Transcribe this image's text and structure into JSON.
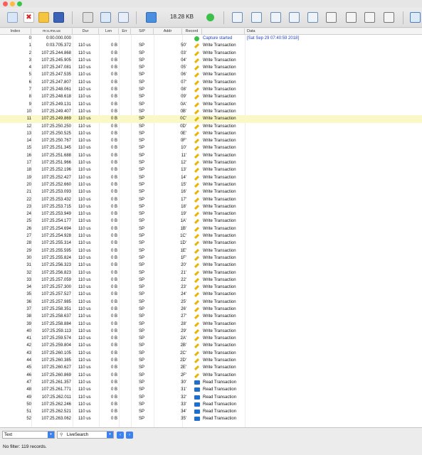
{
  "toolbar": {
    "capture_size": "18.28 KB"
  },
  "columns": {
    "index": "Index",
    "timestamp": "m:s.ms.us",
    "dur": "Dur",
    "len": "Len",
    "err": "Err",
    "sp": "S/P",
    "addr": "Addr",
    "record": "Record",
    "data": "Data"
  },
  "rows": [
    {
      "index": "0",
      "ts": "0:00.000.000",
      "dur": "",
      "len": "",
      "sp": "",
      "addr": "",
      "kind": "start",
      "record": "Capture started",
      "data": "[Sat Sep 29 07:40:59 2018]"
    },
    {
      "index": "1",
      "ts": "0:03.705.372",
      "dur": "110 us",
      "len": "0 B",
      "sp": "SP",
      "addr": "50'",
      "kind": "write",
      "record": "Write Transaction",
      "data": ""
    },
    {
      "index": "2",
      "ts": "107:25.244.868",
      "dur": "110 us",
      "len": "0 B",
      "sp": "SP",
      "addr": "03'",
      "kind": "write",
      "record": "Write Transaction",
      "data": ""
    },
    {
      "index": "3",
      "ts": "107:25.245.905",
      "dur": "110 us",
      "len": "0 B",
      "sp": "SP",
      "addr": "04'",
      "kind": "write",
      "record": "Write Transaction",
      "data": ""
    },
    {
      "index": "4",
      "ts": "107:25.247.081",
      "dur": "110 us",
      "len": "0 B",
      "sp": "SP",
      "addr": "05'",
      "kind": "write",
      "record": "Write Transaction",
      "data": ""
    },
    {
      "index": "5",
      "ts": "107:25.247.535",
      "dur": "110 us",
      "len": "0 B",
      "sp": "SP",
      "addr": "06'",
      "kind": "write",
      "record": "Write Transaction",
      "data": ""
    },
    {
      "index": "6",
      "ts": "107:25.247.807",
      "dur": "110 us",
      "len": "0 B",
      "sp": "SP",
      "addr": "07'",
      "kind": "write",
      "record": "Write Transaction",
      "data": ""
    },
    {
      "index": "7",
      "ts": "107:25.248.061",
      "dur": "110 us",
      "len": "0 B",
      "sp": "SP",
      "addr": "08'",
      "kind": "write",
      "record": "Write Transaction",
      "data": ""
    },
    {
      "index": "8",
      "ts": "107:25.248.618",
      "dur": "110 us",
      "len": "0 B",
      "sp": "SP",
      "addr": "09'",
      "kind": "write",
      "record": "Write Transaction",
      "data": ""
    },
    {
      "index": "9",
      "ts": "107:25.249.131",
      "dur": "110 us",
      "len": "0 B",
      "sp": "SP",
      "addr": "0A'",
      "kind": "write",
      "record": "Write Transaction",
      "data": ""
    },
    {
      "index": "10",
      "ts": "107:25.249.407",
      "dur": "110 us",
      "len": "0 B",
      "sp": "SP",
      "addr": "0B'",
      "kind": "write",
      "record": "Write Transaction",
      "data": ""
    },
    {
      "index": "11",
      "ts": "107:25.249.869",
      "dur": "110 us",
      "len": "0 B",
      "sp": "SP",
      "addr": "0C'",
      "kind": "write",
      "record": "Write Transaction",
      "data": "",
      "selected": true
    },
    {
      "index": "12",
      "ts": "107:25.250.250",
      "dur": "110 us",
      "len": "0 B",
      "sp": "SP",
      "addr": "0D'",
      "kind": "write",
      "record": "Write Transaction",
      "data": ""
    },
    {
      "index": "13",
      "ts": "107:25.250.525",
      "dur": "110 us",
      "len": "0 B",
      "sp": "SP",
      "addr": "0E'",
      "kind": "write",
      "record": "Write Transaction",
      "data": ""
    },
    {
      "index": "14",
      "ts": "107:25.250.767",
      "dur": "110 us",
      "len": "0 B",
      "sp": "SP",
      "addr": "0F'",
      "kind": "write",
      "record": "Write Transaction",
      "data": ""
    },
    {
      "index": "15",
      "ts": "107:25.251.345",
      "dur": "110 us",
      "len": "0 B",
      "sp": "SP",
      "addr": "10'",
      "kind": "write",
      "record": "Write Transaction",
      "data": ""
    },
    {
      "index": "16",
      "ts": "107:25.251.688",
      "dur": "110 us",
      "len": "0 B",
      "sp": "SP",
      "addr": "11'",
      "kind": "write",
      "record": "Write Transaction",
      "data": ""
    },
    {
      "index": "17",
      "ts": "107:25.251.966",
      "dur": "110 us",
      "len": "0 B",
      "sp": "SP",
      "addr": "12'",
      "kind": "write",
      "record": "Write Transaction",
      "data": ""
    },
    {
      "index": "18",
      "ts": "107:25.252.196",
      "dur": "110 us",
      "len": "0 B",
      "sp": "SP",
      "addr": "13'",
      "kind": "write",
      "record": "Write Transaction",
      "data": ""
    },
    {
      "index": "19",
      "ts": "107:25.252.427",
      "dur": "110 us",
      "len": "0 B",
      "sp": "SP",
      "addr": "14'",
      "kind": "write",
      "record": "Write Transaction",
      "data": ""
    },
    {
      "index": "20",
      "ts": "107:25.252.660",
      "dur": "110 us",
      "len": "0 B",
      "sp": "SP",
      "addr": "15'",
      "kind": "write",
      "record": "Write Transaction",
      "data": ""
    },
    {
      "index": "21",
      "ts": "107:25.253.093",
      "dur": "110 us",
      "len": "0 B",
      "sp": "SP",
      "addr": "16'",
      "kind": "write",
      "record": "Write Transaction",
      "data": ""
    },
    {
      "index": "22",
      "ts": "107:25.253.432",
      "dur": "110 us",
      "len": "0 B",
      "sp": "SP",
      "addr": "17'",
      "kind": "write",
      "record": "Write Transaction",
      "data": ""
    },
    {
      "index": "23",
      "ts": "107:25.253.715",
      "dur": "110 us",
      "len": "0 B",
      "sp": "SP",
      "addr": "18'",
      "kind": "write",
      "record": "Write Transaction",
      "data": ""
    },
    {
      "index": "24",
      "ts": "107:25.253.949",
      "dur": "110 us",
      "len": "0 B",
      "sp": "SP",
      "addr": "19'",
      "kind": "write",
      "record": "Write Transaction",
      "data": ""
    },
    {
      "index": "25",
      "ts": "107:25.254.177",
      "dur": "110 us",
      "len": "0 B",
      "sp": "SP",
      "addr": "1A'",
      "kind": "write",
      "record": "Write Transaction",
      "data": ""
    },
    {
      "index": "26",
      "ts": "107:25.254.694",
      "dur": "110 us",
      "len": "0 B",
      "sp": "SP",
      "addr": "1B'",
      "kind": "write",
      "record": "Write Transaction",
      "data": ""
    },
    {
      "index": "27",
      "ts": "107:25.254.928",
      "dur": "110 us",
      "len": "0 B",
      "sp": "SP",
      "addr": "1C'",
      "kind": "write",
      "record": "Write Transaction",
      "data": ""
    },
    {
      "index": "28",
      "ts": "107:25.255.314",
      "dur": "110 us",
      "len": "0 B",
      "sp": "SP",
      "addr": "1D'",
      "kind": "write",
      "record": "Write Transaction",
      "data": ""
    },
    {
      "index": "29",
      "ts": "107:25.255.595",
      "dur": "110 us",
      "len": "0 B",
      "sp": "SP",
      "addr": "1E'",
      "kind": "write",
      "record": "Write Transaction",
      "data": ""
    },
    {
      "index": "30",
      "ts": "107:25.255.824",
      "dur": "110 us",
      "len": "0 B",
      "sp": "SP",
      "addr": "1F'",
      "kind": "write",
      "record": "Write Transaction",
      "data": ""
    },
    {
      "index": "31",
      "ts": "107:25.256.323",
      "dur": "110 us",
      "len": "0 B",
      "sp": "SP",
      "addr": "20'",
      "kind": "write",
      "record": "Write Transaction",
      "data": ""
    },
    {
      "index": "32",
      "ts": "107:25.256.823",
      "dur": "110 us",
      "len": "0 B",
      "sp": "SP",
      "addr": "21'",
      "kind": "write",
      "record": "Write Transaction",
      "data": ""
    },
    {
      "index": "33",
      "ts": "107:25.257.059",
      "dur": "110 us",
      "len": "0 B",
      "sp": "SP",
      "addr": "22'",
      "kind": "write",
      "record": "Write Transaction",
      "data": ""
    },
    {
      "index": "34",
      "ts": "107:25.257.300",
      "dur": "110 us",
      "len": "0 B",
      "sp": "SP",
      "addr": "23'",
      "kind": "write",
      "record": "Write Transaction",
      "data": ""
    },
    {
      "index": "35",
      "ts": "107:25.257.527",
      "dur": "110 us",
      "len": "0 B",
      "sp": "SP",
      "addr": "24'",
      "kind": "write",
      "record": "Write Transaction",
      "data": ""
    },
    {
      "index": "36",
      "ts": "107:25.257.985",
      "dur": "110 us",
      "len": "0 B",
      "sp": "SP",
      "addr": "25'",
      "kind": "write",
      "record": "Write Transaction",
      "data": ""
    },
    {
      "index": "37",
      "ts": "107:25.258.351",
      "dur": "110 us",
      "len": "0 B",
      "sp": "SP",
      "addr": "26'",
      "kind": "write",
      "record": "Write Transaction",
      "data": ""
    },
    {
      "index": "38",
      "ts": "107:25.258.637",
      "dur": "110 us",
      "len": "0 B",
      "sp": "SP",
      "addr": "27'",
      "kind": "write",
      "record": "Write Transaction",
      "data": ""
    },
    {
      "index": "39",
      "ts": "107:25.258.884",
      "dur": "110 us",
      "len": "0 B",
      "sp": "SP",
      "addr": "28'",
      "kind": "write",
      "record": "Write Transaction",
      "data": ""
    },
    {
      "index": "40",
      "ts": "107:25.259.113",
      "dur": "110 us",
      "len": "0 B",
      "sp": "SP",
      "addr": "29'",
      "kind": "write",
      "record": "Write Transaction",
      "data": ""
    },
    {
      "index": "41",
      "ts": "107:25.259.574",
      "dur": "110 us",
      "len": "0 B",
      "sp": "SP",
      "addr": "2A'",
      "kind": "write",
      "record": "Write Transaction",
      "data": ""
    },
    {
      "index": "42",
      "ts": "107:25.259.804",
      "dur": "110 us",
      "len": "0 B",
      "sp": "SP",
      "addr": "2B'",
      "kind": "write",
      "record": "Write Transaction",
      "data": ""
    },
    {
      "index": "43",
      "ts": "107:25.260.105",
      "dur": "110 us",
      "len": "0 B",
      "sp": "SP",
      "addr": "2C'",
      "kind": "write",
      "record": "Write Transaction",
      "data": ""
    },
    {
      "index": "44",
      "ts": "107:25.260.385",
      "dur": "110 us",
      "len": "0 B",
      "sp": "SP",
      "addr": "2D'",
      "kind": "write",
      "record": "Write Transaction",
      "data": ""
    },
    {
      "index": "45",
      "ts": "107:25.260.627",
      "dur": "110 us",
      "len": "0 B",
      "sp": "SP",
      "addr": "2E'",
      "kind": "write",
      "record": "Write Transaction",
      "data": ""
    },
    {
      "index": "46",
      "ts": "107:25.260.869",
      "dur": "110 us",
      "len": "0 B",
      "sp": "SP",
      "addr": "2F'",
      "kind": "write",
      "record": "Write Transaction",
      "data": ""
    },
    {
      "index": "47",
      "ts": "107:25.261.357",
      "dur": "110 us",
      "len": "0 B",
      "sp": "SP",
      "addr": "30'",
      "kind": "read",
      "record": "Read Transaction",
      "data": ""
    },
    {
      "index": "48",
      "ts": "107:25.261.771",
      "dur": "110 us",
      "len": "0 B",
      "sp": "SP",
      "addr": "31'",
      "kind": "read",
      "record": "Read Transaction",
      "data": ""
    },
    {
      "index": "49",
      "ts": "107:25.262.011",
      "dur": "110 us",
      "len": "0 B",
      "sp": "SP",
      "addr": "32'",
      "kind": "read",
      "record": "Read Transaction",
      "data": ""
    },
    {
      "index": "50",
      "ts": "107:25.262.246",
      "dur": "110 us",
      "len": "0 B",
      "sp": "SP",
      "addr": "33'",
      "kind": "read",
      "record": "Read Transaction",
      "data": ""
    },
    {
      "index": "51",
      "ts": "107:25.262.521",
      "dur": "110 us",
      "len": "0 B",
      "sp": "SP",
      "addr": "34'",
      "kind": "read",
      "record": "Read Transaction",
      "data": ""
    },
    {
      "index": "52",
      "ts": "107:25.263.062",
      "dur": "110 us",
      "len": "0 B",
      "sp": "SP",
      "addr": "35'",
      "kind": "read",
      "record": "Read Transaction",
      "data": ""
    }
  ],
  "bottom": {
    "view_select": "Text",
    "search_placeholder": "LiveSearch",
    "status": "No filter: 119 records."
  },
  "colors": {
    "selected_row": "#fbf8c7",
    "start_text": "#1d3fd6",
    "write_icon": "#e8b600",
    "read_icon": "#1f6fd1",
    "accent": "#3b82f0"
  }
}
